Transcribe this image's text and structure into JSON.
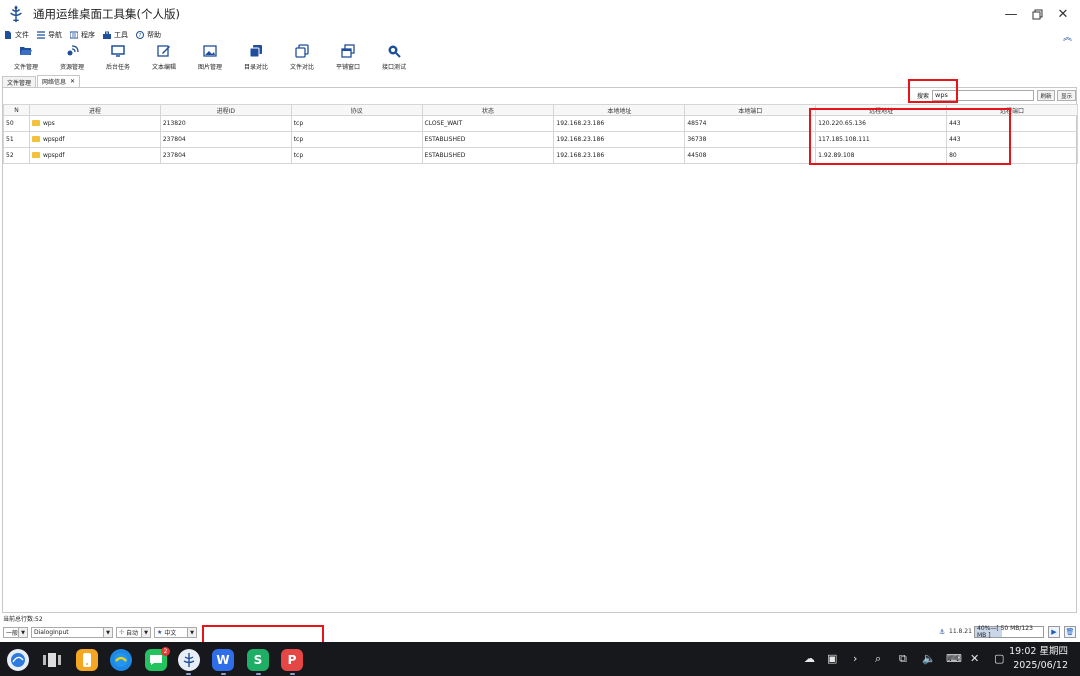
{
  "window": {
    "title": "通用运维桌面工具集(个人版)"
  },
  "menu": [
    {
      "label": "文件",
      "icon": "file-icon"
    },
    {
      "label": "导航",
      "icon": "list-icon"
    },
    {
      "label": "程序",
      "icon": "keyboard-icon"
    },
    {
      "label": "工具",
      "icon": "toolbox-icon"
    },
    {
      "label": "帮助",
      "icon": "help-icon"
    }
  ],
  "toolbar": [
    {
      "label": "文件管理",
      "icon": "folder-open-icon"
    },
    {
      "label": "资源管理",
      "icon": "satellite-icon"
    },
    {
      "label": "后台任务",
      "icon": "monitor-icon"
    },
    {
      "label": "文本编辑",
      "icon": "edit-icon"
    },
    {
      "label": "图片管理",
      "icon": "image-icon"
    },
    {
      "label": "目录对比",
      "icon": "copy-icon"
    },
    {
      "label": "文件对比",
      "icon": "file-compare-icon"
    },
    {
      "label": "平铺窗口",
      "icon": "windows-icon"
    },
    {
      "label": "接口测试",
      "icon": "search-zoom-icon"
    }
  ],
  "tabs": [
    {
      "label": "文件管理",
      "active": false
    },
    {
      "label": "网络信息",
      "active": true
    }
  ],
  "search": {
    "label": "搜索",
    "value": "wps",
    "refresh_label": "刷新",
    "show_label": "显示"
  },
  "table": {
    "columns": [
      "N",
      "进程",
      "进程ID",
      "协议",
      "状态",
      "本地地址",
      "本地端口",
      "远程地址",
      "远程端口"
    ],
    "rows": [
      {
        "n": "50",
        "process": "wps",
        "pid": "213820",
        "proto": "tcp",
        "state": "CLOSE_WAIT",
        "local_addr": "192.168.23.186",
        "local_port": "48574",
        "remote_addr": "120.220.65.136",
        "remote_port": "443"
      },
      {
        "n": "51",
        "process": "wpspdf",
        "pid": "237804",
        "proto": "tcp",
        "state": "ESTABLISHED",
        "local_addr": "192.168.23.186",
        "local_port": "36738",
        "remote_addr": "117.185.108.111",
        "remote_port": "443"
      },
      {
        "n": "52",
        "process": "wpspdf",
        "pid": "237804",
        "proto": "tcp",
        "state": "ESTABLISHED",
        "local_addr": "192.168.23.186",
        "local_port": "44508",
        "remote_addr": "1.92.89.108",
        "remote_port": "80"
      }
    ]
  },
  "status": {
    "row_count": "当前总行数:52",
    "select1": "一般",
    "select2": "DialogInput",
    "select3": "自动",
    "select4": "中文",
    "version": "11.8.21",
    "memory": "40%—[ 50 MB/123 MB ]",
    "memory_fraction": 0.4
  },
  "taskbar": {
    "badge": "2",
    "time": "19:02 星期四",
    "date": "2025/06/12",
    "app_letters": {
      "wps": "W",
      "sheet": "S",
      "pdf": "P"
    }
  },
  "colors": {
    "highlight": "#e8141c",
    "accent": "#1f4f9c",
    "folder": "#f2c23c",
    "taskbar": "#16181c"
  }
}
